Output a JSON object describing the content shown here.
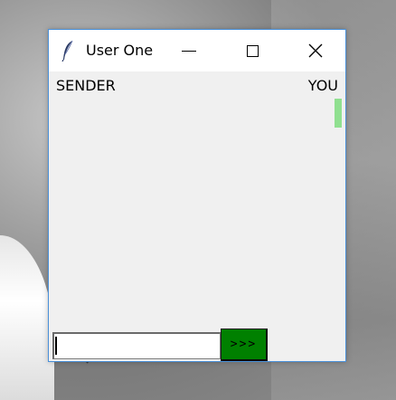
{
  "window": {
    "title": "User One",
    "icon": "feather-icon"
  },
  "header": {
    "sender_label": "SENDER",
    "you_label": "YOU"
  },
  "composer": {
    "input_value": "",
    "send_label": ">>>"
  },
  "colors": {
    "send_button": "#008000",
    "you_indicator": "#90e090",
    "window_border": "#4a90d9"
  }
}
